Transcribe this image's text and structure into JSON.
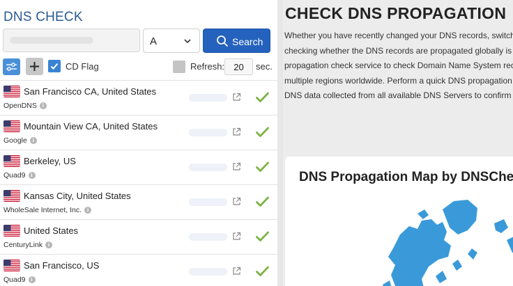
{
  "app": {
    "title": "DNS CHECK"
  },
  "search": {
    "domain_value": "",
    "record_type": "A",
    "button_label": "Search"
  },
  "options": {
    "cd_flag_label": "CD Flag",
    "cd_flag_checked": true,
    "refresh_label": "Refresh:",
    "refresh_value": "20",
    "refresh_unit": "sec.",
    "refresh_checked": false
  },
  "servers": [
    {
      "location": "San Francisco CA, United States",
      "provider": "OpenDNS",
      "flag": "us-flag-icon",
      "status": "ok-check-icon"
    },
    {
      "location": "Mountain View CA, United States",
      "provider": "Google",
      "flag": "us-flag-icon",
      "status": "ok-check-icon"
    },
    {
      "location": "Berkeley, US",
      "provider": "Quad9",
      "flag": "us-flag-icon",
      "status": "ok-check-icon"
    },
    {
      "location": "Kansas City, United States",
      "provider": "WholeSale Internet, Inc.",
      "flag": "us-flag-icon",
      "status": "ok-check-icon"
    },
    {
      "location": "United States",
      "provider": "CenturyLink",
      "flag": "us-flag-icon",
      "status": "ok-check-icon"
    },
    {
      "location": "San Francisco, US",
      "provider": "Quad9",
      "flag": "us-flag-icon",
      "status": "ok-check-icon"
    }
  ],
  "content": {
    "heading": "CHECK DNS PROPAGATION",
    "paragraph_lines": [
      "Whether you have recently changed your DNS records, switch",
      "checking whether the DNS records are propagated globally is e",
      "propagation check service to check Domain Name System reco",
      "multiple regions worldwide. Perform a quick DNS propagation",
      "DNS data collected from all available DNS Servers to confirm t"
    ],
    "map_title": "DNS Propagation Map by DNSChe"
  },
  "colors": {
    "accent": "#2462bd",
    "title": "#2a5b93",
    "check_green": "#7cb342",
    "map_blue": "#3a9ad9"
  }
}
